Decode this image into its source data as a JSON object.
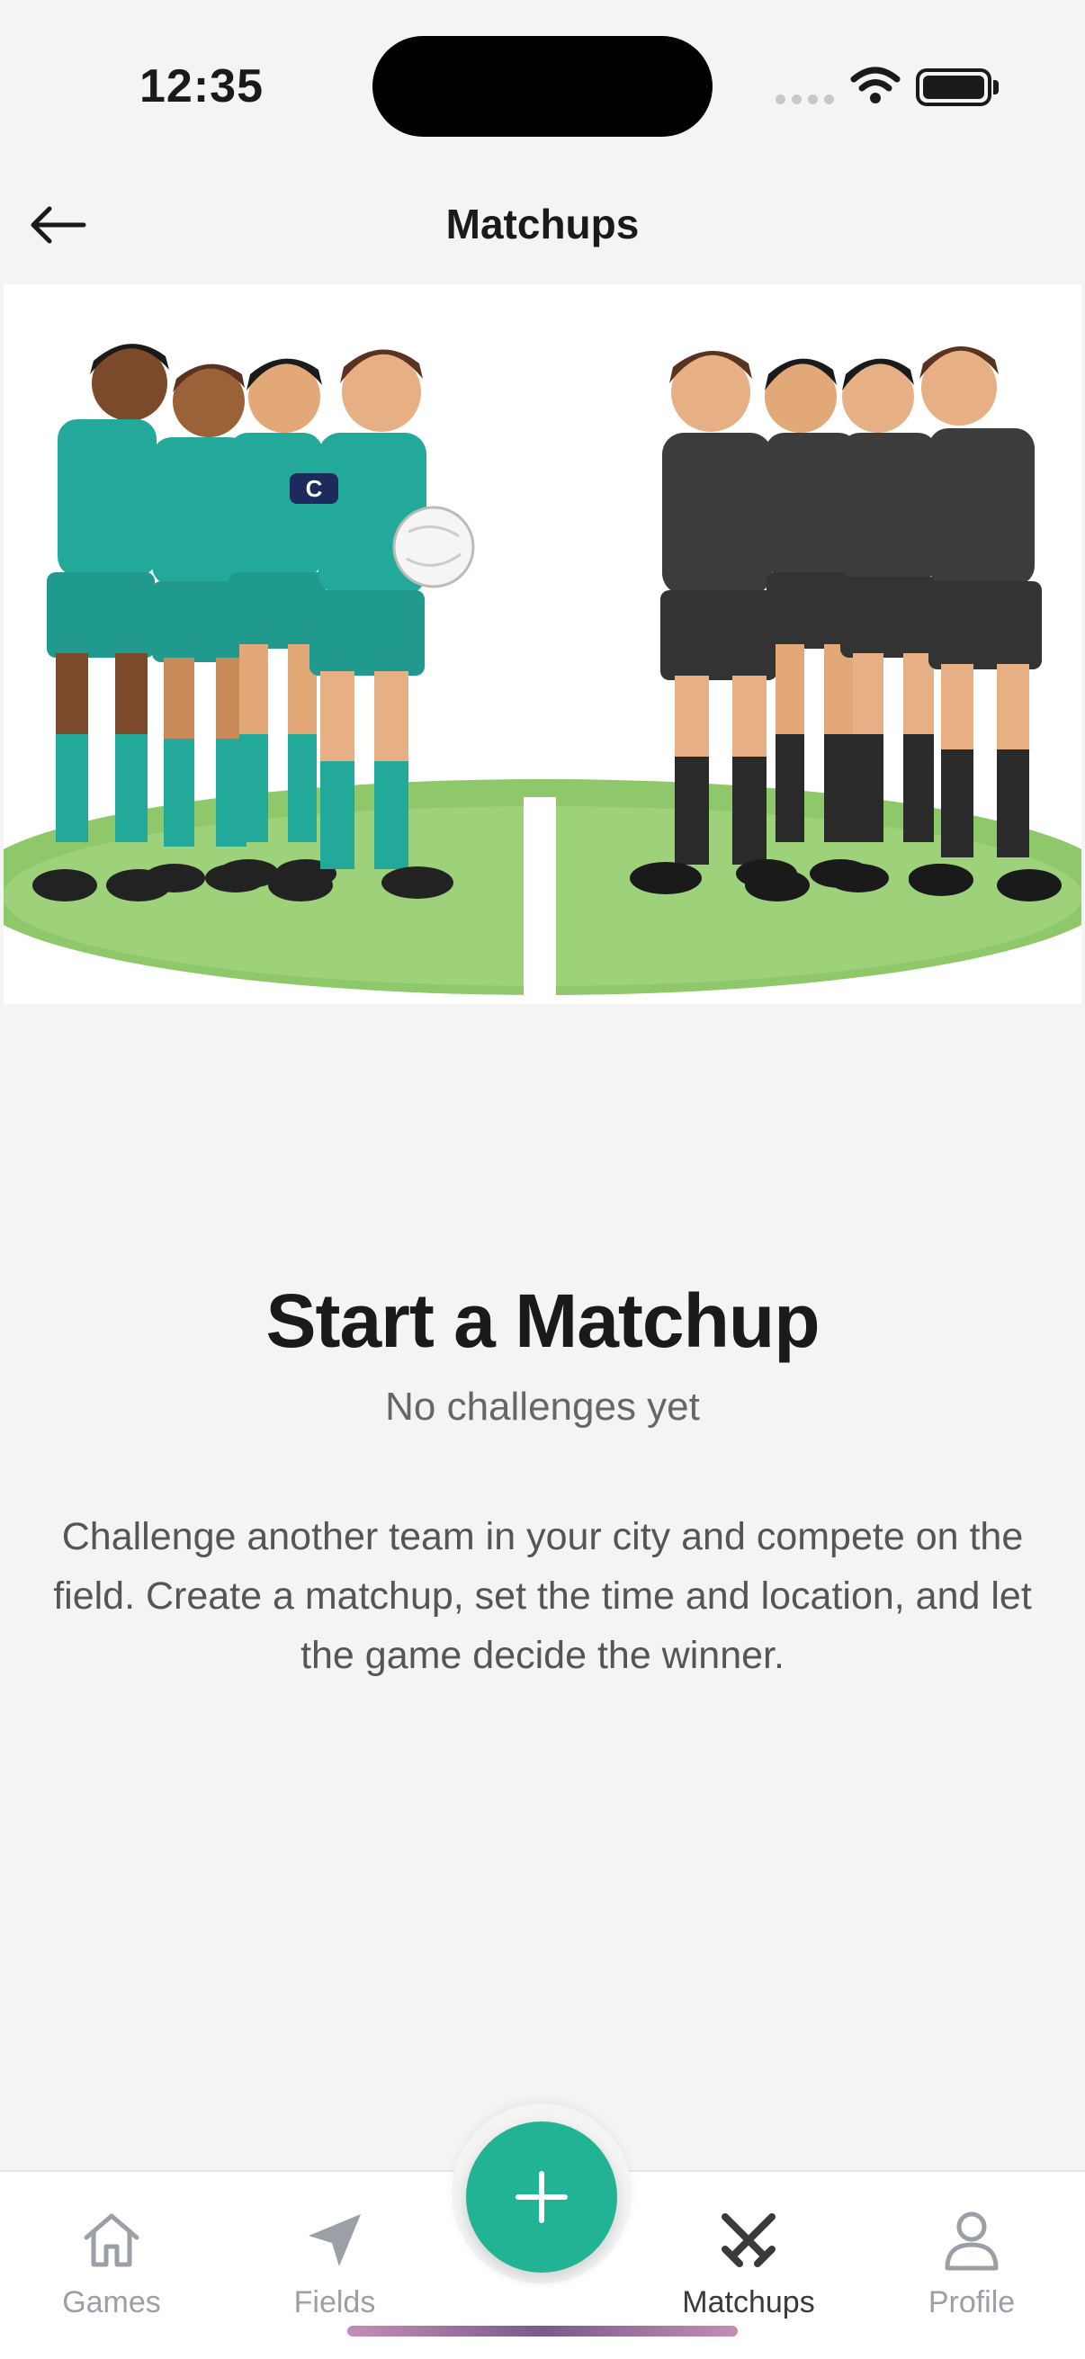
{
  "status_bar": {
    "time": "12:35"
  },
  "header": {
    "title": "Matchups",
    "back_icon": "arrow-left-icon"
  },
  "hero": {
    "team_a_color": "#22a99a",
    "team_b_color": "#3c3c3c",
    "armband_letter": "C",
    "field_color": "#8fc86a"
  },
  "empty_state": {
    "title": "Start a Matchup",
    "subtitle": "No challenges yet",
    "description": "Challenge another team in your city and compete on the field. Create a matchup, set the time and location, and let the game decide the winner."
  },
  "nav": {
    "items": [
      {
        "label": "Games",
        "icon": "home-icon",
        "active": false
      },
      {
        "label": "Fields",
        "icon": "navigation-arrow-icon",
        "active": false
      },
      {
        "label": "Matchups",
        "icon": "crossed-swords-icon",
        "active": true
      },
      {
        "label": "Profile",
        "icon": "user-icon",
        "active": false
      }
    ],
    "fab_icon": "plus-icon",
    "accent": "#22b395"
  }
}
